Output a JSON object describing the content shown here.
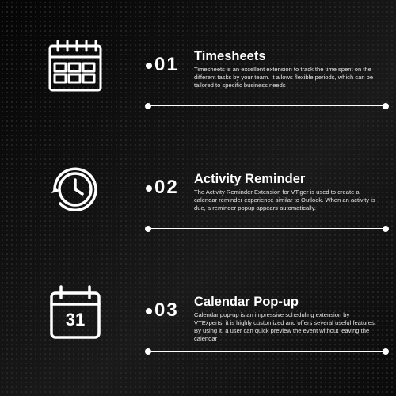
{
  "items": [
    {
      "n": "01",
      "title": "Timesheets",
      "desc": "Timesheets is an excellent extension to track the time spent on the different tasks by your team. It allows flexible periods, which can be tailored to specific business needs"
    },
    {
      "n": "02",
      "title": "Activity Reminder",
      "desc": "The Activity Reminder Extension for VTiger is used to create a calendar reminder experience similar to Outlook. When an activity is due, a reminder popup appears automatically."
    },
    {
      "n": "03",
      "title": "Calendar Pop-up",
      "desc": "Calendar pop-up is an impressive scheduling extension by VTExperts, it is highly customized and offers several useful features. By using it, a user can quick preview the event without leaving the calendar"
    }
  ]
}
